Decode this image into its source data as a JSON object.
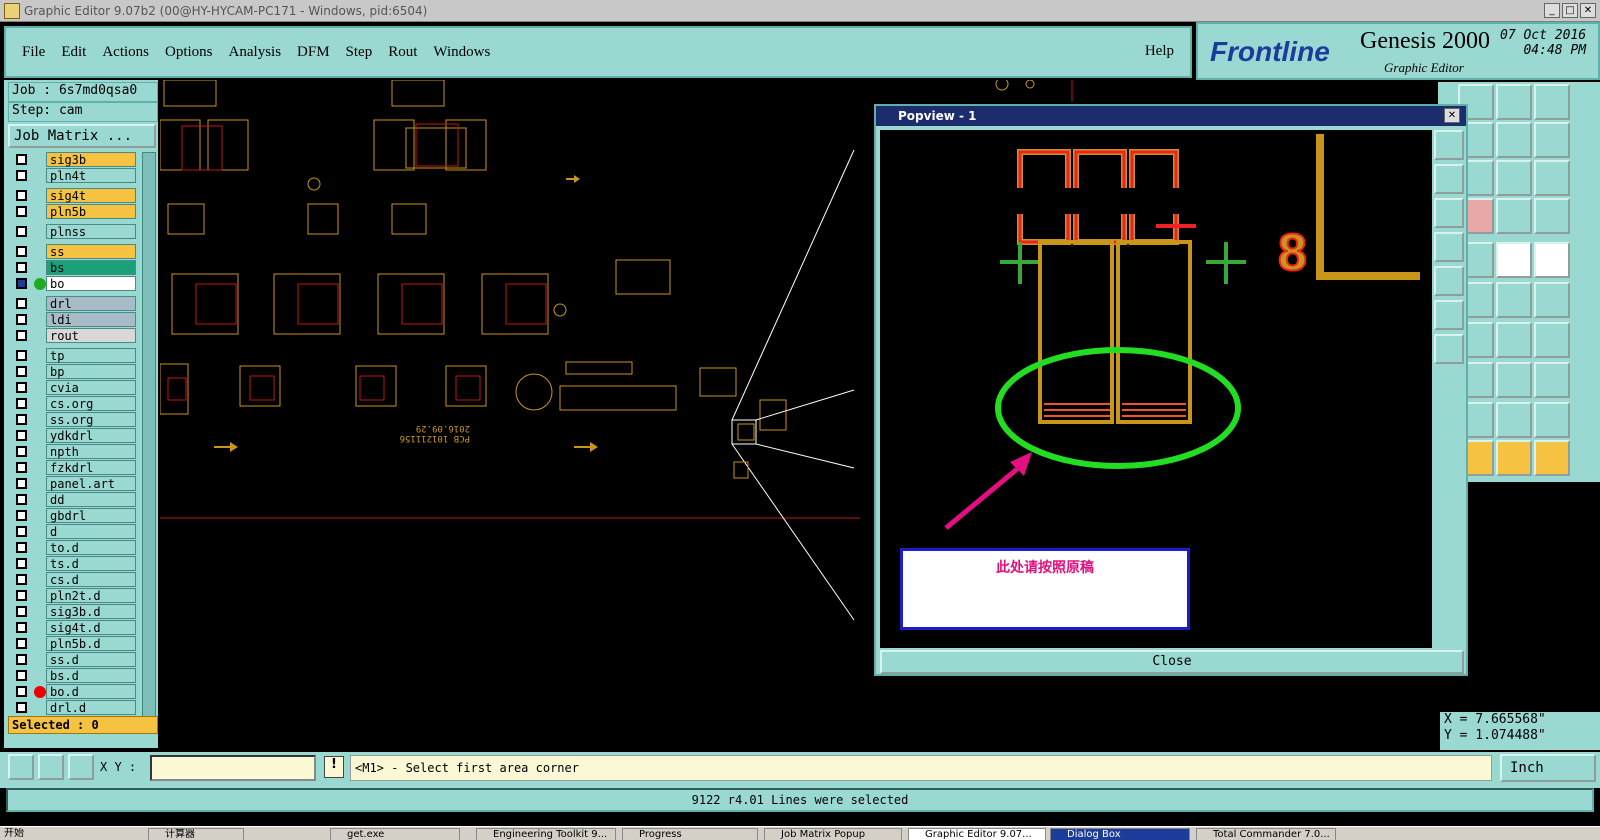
{
  "window": {
    "title": "Graphic Editor 9.07b2 (00@HY-HYCAM-PC171 - Windows, pid:6504)"
  },
  "menu": {
    "items": [
      "File",
      "Edit",
      "Actions",
      "Options",
      "Analysis",
      "DFM",
      "Step",
      "Rout",
      "Windows"
    ],
    "help": "Help"
  },
  "brand": {
    "logo": "Frontline",
    "product": "Genesis 2000",
    "subtitle": "Graphic Editor",
    "date": "07 Oct 2016",
    "time": "04:48 PM"
  },
  "job": {
    "job_label": "Job : 6s7md0qsa0",
    "step_label": "Step: cam",
    "matrix_button": "Job Matrix ..."
  },
  "layers": [
    {
      "name": "sig3b",
      "color": "#f5c242"
    },
    {
      "name": "pln4t",
      "color": "#9ad9d2"
    },
    {
      "name": "sig4t",
      "color": "#f5c242"
    },
    {
      "name": "pln5b",
      "color": "#f5c242"
    },
    {
      "name": "plnss",
      "color": "#9ad9d2"
    },
    {
      "name": "ss",
      "color": "#f5c242"
    },
    {
      "name": "bs",
      "color": "#1aa07a"
    },
    {
      "name": "bo",
      "color": "#ffffff"
    },
    {
      "name": "drl",
      "color": "#a8bcc8"
    },
    {
      "name": "ldi",
      "color": "#a8bcc8"
    },
    {
      "name": "rout",
      "color": "#d8d8d8"
    },
    {
      "name": "tp",
      "color": "#9ad9d2"
    },
    {
      "name": "bp",
      "color": "#9ad9d2"
    },
    {
      "name": "cvia",
      "color": "#9ad9d2"
    },
    {
      "name": "cs.org",
      "color": "#9ad9d2"
    },
    {
      "name": "ss.org",
      "color": "#9ad9d2"
    },
    {
      "name": "ydkdrl",
      "color": "#9ad9d2"
    },
    {
      "name": "npth",
      "color": "#9ad9d2"
    },
    {
      "name": "fzkdrl",
      "color": "#9ad9d2"
    },
    {
      "name": "panel.art",
      "color": "#9ad9d2"
    },
    {
      "name": "dd",
      "color": "#9ad9d2"
    },
    {
      "name": "gbdrl",
      "color": "#9ad9d2"
    },
    {
      "name": "d",
      "color": "#9ad9d2"
    },
    {
      "name": "to.d",
      "color": "#9ad9d2"
    },
    {
      "name": "ts.d",
      "color": "#9ad9d2"
    },
    {
      "name": "cs.d",
      "color": "#9ad9d2"
    },
    {
      "name": "pln2t.d",
      "color": "#9ad9d2"
    },
    {
      "name": "sig3b.d",
      "color": "#9ad9d2"
    },
    {
      "name": "sig4t.d",
      "color": "#9ad9d2"
    },
    {
      "name": "pln5b.d",
      "color": "#9ad9d2"
    },
    {
      "name": "ss.d",
      "color": "#9ad9d2"
    },
    {
      "name": "bs.d",
      "color": "#9ad9d2"
    },
    {
      "name": "bo.d",
      "color": "#9ad9d2"
    },
    {
      "name": "drl.d",
      "color": "#9ad9d2"
    }
  ],
  "selected_label": "Selected : 0",
  "command": {
    "xy_label": "X Y :",
    "xy_value": "",
    "prompt": "<M1> - Select first area corner",
    "units": "Inch"
  },
  "status": "9122 r4.01 Lines were selected",
  "coordinates": {
    "x": "X = 7.665568\"",
    "y": "Y = 1.074488\""
  },
  "popview": {
    "title": "Popview - 1",
    "note": "此处请按照原稿",
    "close": "Close"
  },
  "pcb_text": {
    "line1": "PCB 101211156",
    "line2": "2016.09.29"
  },
  "taskbar": [
    "开始",
    "",
    "计算器",
    "",
    "get.exe",
    "Engineering Toolkit 9...",
    "Progress",
    "Job Matrix Popup",
    "Graphic Editor 9.07...",
    "Dialog Box",
    "Total Commander 7.0..."
  ]
}
